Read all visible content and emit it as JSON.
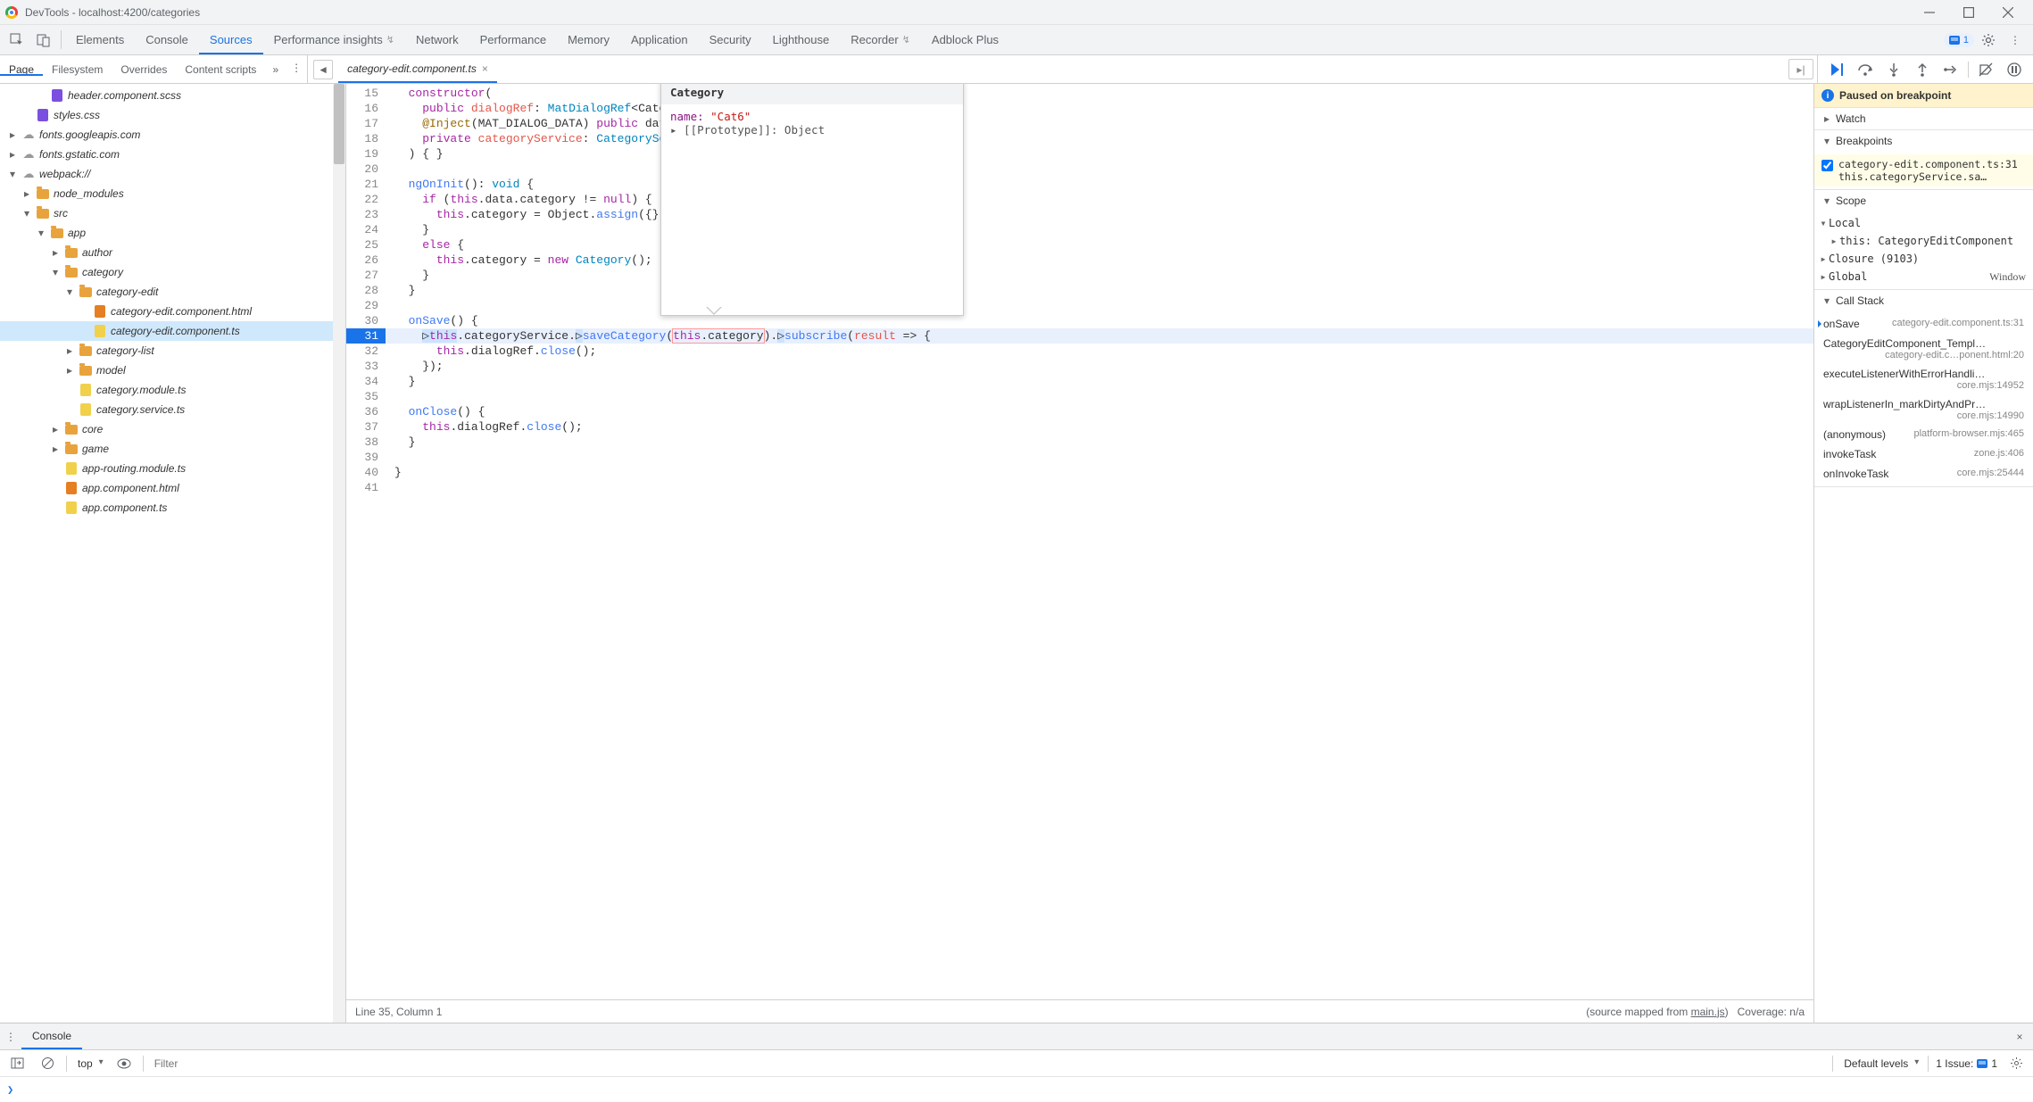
{
  "window": {
    "title": "DevTools - localhost:4200/categories"
  },
  "mainTabs": {
    "items": [
      "Elements",
      "Console",
      "Sources",
      "Performance insights",
      "Network",
      "Performance",
      "Memory",
      "Application",
      "Security",
      "Lighthouse",
      "Recorder",
      "Adblock Plus"
    ],
    "active": "Sources",
    "preview": [
      3,
      10
    ],
    "issues_count": "1"
  },
  "subTabs": {
    "items": [
      "Page",
      "Filesystem",
      "Overrides",
      "Content scripts"
    ],
    "active": "Page",
    "more": "»"
  },
  "openFile": {
    "name": "category-edit.component.ts"
  },
  "tree": [
    {
      "d": 2,
      "tw": "",
      "ic": "scss",
      "label": "header.component.scss"
    },
    {
      "d": 1,
      "tw": "",
      "ic": "scss",
      "label": "styles.css"
    },
    {
      "d": 0,
      "tw": "▸",
      "ic": "cloud",
      "label": "fonts.googleapis.com"
    },
    {
      "d": 0,
      "tw": "▸",
      "ic": "cloud",
      "label": "fonts.gstatic.com"
    },
    {
      "d": 0,
      "tw": "▾",
      "ic": "cloud",
      "label": "webpack://"
    },
    {
      "d": 1,
      "tw": "▸",
      "ic": "folder",
      "label": "node_modules"
    },
    {
      "d": 1,
      "tw": "▾",
      "ic": "folder",
      "label": "src"
    },
    {
      "d": 2,
      "tw": "▾",
      "ic": "folder",
      "label": "app"
    },
    {
      "d": 3,
      "tw": "▸",
      "ic": "folder",
      "label": "author"
    },
    {
      "d": 3,
      "tw": "▾",
      "ic": "folder",
      "label": "category"
    },
    {
      "d": 4,
      "tw": "▾",
      "ic": "folder",
      "label": "category-edit"
    },
    {
      "d": 5,
      "tw": "",
      "ic": "html",
      "label": "category-edit.component.html"
    },
    {
      "d": 5,
      "tw": "",
      "ic": "js",
      "label": "category-edit.component.ts",
      "sel": true
    },
    {
      "d": 4,
      "tw": "▸",
      "ic": "folder",
      "label": "category-list"
    },
    {
      "d": 4,
      "tw": "▸",
      "ic": "folder",
      "label": "model"
    },
    {
      "d": 4,
      "tw": "",
      "ic": "js",
      "label": "category.module.ts"
    },
    {
      "d": 4,
      "tw": "",
      "ic": "js",
      "label": "category.service.ts"
    },
    {
      "d": 3,
      "tw": "▸",
      "ic": "folder",
      "label": "core"
    },
    {
      "d": 3,
      "tw": "▸",
      "ic": "folder",
      "label": "game"
    },
    {
      "d": 3,
      "tw": "",
      "ic": "js",
      "label": "app-routing.module.ts"
    },
    {
      "d": 3,
      "tw": "",
      "ic": "html",
      "label": "app.component.html"
    },
    {
      "d": 3,
      "tw": "",
      "ic": "js",
      "label": "app.component.ts"
    }
  ],
  "code": {
    "firstLine": 15,
    "breakpointLine": 31,
    "lines": [
      {
        "html": "  <span class='tok-kw'>constructor</span>("
      },
      {
        "html": "    <span class='tok-kw'>public</span> <span class='tok-id'>dialogRef</span>: <span class='tok-type'>MatDialogRef</span>&lt;Cate"
      },
      {
        "html": "    <span class='tok-decor'>@Inject</span>(MAT_DIALOG_DATA) <span class='tok-kw'>public</span> dat"
      },
      {
        "html": "    <span class='tok-kw'>private</span> <span class='tok-id'>categoryService</span>: <span class='tok-type'>CategorySe</span>"
      },
      {
        "html": "  ) { }"
      },
      {
        "html": ""
      },
      {
        "html": "  <span class='tok-fn'>ngOnInit</span>(): <span class='tok-type'>void</span> {"
      },
      {
        "html": "    <span class='tok-kw'>if</span> (<span class='tok-this'>this</span>.data.category != <span class='tok-null'>null</span>) {"
      },
      {
        "html": "      <span class='tok-this'>this</span>.category = Object.<span class='tok-fn'>assign</span>({},"
      },
      {
        "html": "    }"
      },
      {
        "html": "    <span class='tok-kw'>else</span> {"
      },
      {
        "html": "      <span class='tok-this'>this</span>.category = <span class='tok-new'>new</span> <span class='tok-type'>Category</span>();"
      },
      {
        "html": "    }"
      },
      {
        "html": "  }"
      },
      {
        "html": ""
      },
      {
        "html": "  <span class='tok-fn'>onSave</span>() {"
      },
      {
        "html": "    <span style='background:#cde3ff'>▷<span class='tok-this'>this</span></span>.categoryService.<span style='background:#cde3ff'>▷</span><span class='tok-fn'>saveCategory</span>(<span style='outline:1px solid #f99'><span class='tok-this'>this</span>.category</span>).<span style='background:#cde3ff'>▷</span><span class='tok-fn'>subscribe</span>(<span class='tok-id'>result</span> =&gt; {",
        "exec": true
      },
      {
        "html": "      <span class='tok-this'>this</span>.dialogRef.<span class='tok-fn'>close</span>();"
      },
      {
        "html": "    });"
      },
      {
        "html": "  }"
      },
      {
        "html": ""
      },
      {
        "html": "  <span class='tok-fn'>onClose</span>() {"
      },
      {
        "html": "    <span class='tok-this'>this</span>.dialogRef.<span class='tok-fn'>close</span>();"
      },
      {
        "html": "  }"
      },
      {
        "html": ""
      },
      {
        "html": "}"
      },
      {
        "html": ""
      }
    ]
  },
  "hover": {
    "title": "Category",
    "line1_k": "name: ",
    "line1_v": "\"Cat6\"",
    "line2": "▸ [[Prototype]]: Object"
  },
  "status": {
    "pos": "Line 35, Column 1",
    "mapped_prefix": "(source mapped from ",
    "mapped_link": "main.js",
    "mapped_suffix": ")",
    "coverage": "Coverage: n/a"
  },
  "debug": {
    "paused": "Paused on breakpoint",
    "watch": "Watch",
    "breakpoints_hdr": "Breakpoints",
    "bp_file": "category-edit.component.ts:31",
    "bp_code": "this.categoryService.sa…",
    "scope_hdr": "Scope",
    "scope": {
      "local": "Local",
      "this_lbl": "this: ",
      "this_val": "CategoryEditComponent",
      "closure": "Closure (9103)",
      "global": "Global",
      "global_val": "Window"
    },
    "callstack_hdr": "Call Stack",
    "stack": [
      {
        "fn": "onSave",
        "loc": "category-edit.component.ts:31",
        "current": true
      },
      {
        "fn": "CategoryEditComponent_Templ…",
        "loc": "category-edit.c…ponent.html:20"
      },
      {
        "fn": "executeListenerWithErrorHandli…",
        "loc": "core.mjs:14952"
      },
      {
        "fn": "wrapListenerIn_markDirtyAndPr…",
        "loc": "core.mjs:14990"
      },
      {
        "fn": "(anonymous)",
        "loc": "platform-browser.mjs:465"
      },
      {
        "fn": "invokeTask",
        "loc": "zone.js:406"
      },
      {
        "fn": "onInvokeTask",
        "loc": "core.mjs:25444"
      }
    ]
  },
  "drawer": {
    "tab": "Console",
    "context": "top",
    "filter_ph": "Filter",
    "levels": "Default levels",
    "issues_lbl": "1 Issue:",
    "issues_n": "1",
    "prompt": "❯"
  }
}
